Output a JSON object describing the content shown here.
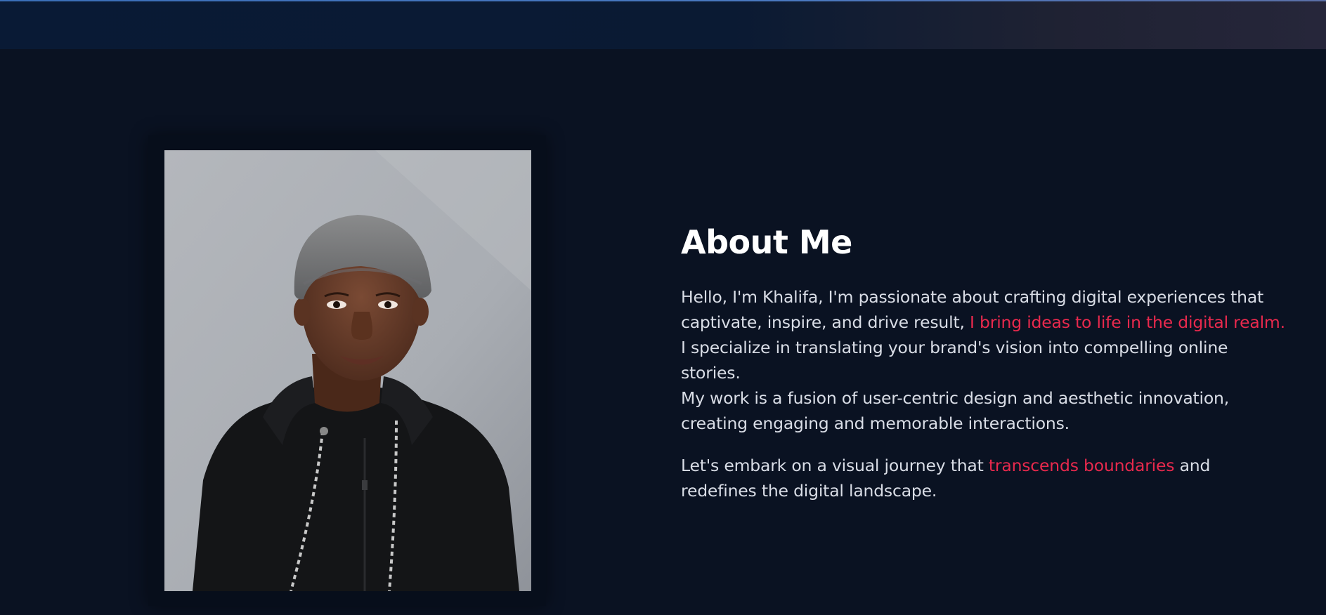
{
  "about": {
    "title": "About Me",
    "p1_part1": "Hello, I'm Khalifa, I'm passionate about crafting digital experiences that captivate, inspire, and drive result, ",
    "p1_highlight": "I bring ideas to life in the digital realm.",
    "p1_part2": " I specialize in translating your brand's vision into compelling online stories.",
    "p1_line2": "My work is a fusion of user-centric design and aesthetic innovation, creating engaging and memorable interactions.",
    "p2_part1": "Let's embark on a visual journey that ",
    "p2_highlight": "transcends boundaries",
    "p2_part2": " and redefines the digital landscape."
  },
  "colors": {
    "background": "#0a1222",
    "heading": "#ffffff",
    "body_text": "#d9dde6",
    "accent": "#e8294d"
  },
  "photo": {
    "subject": "portrait-photo"
  }
}
